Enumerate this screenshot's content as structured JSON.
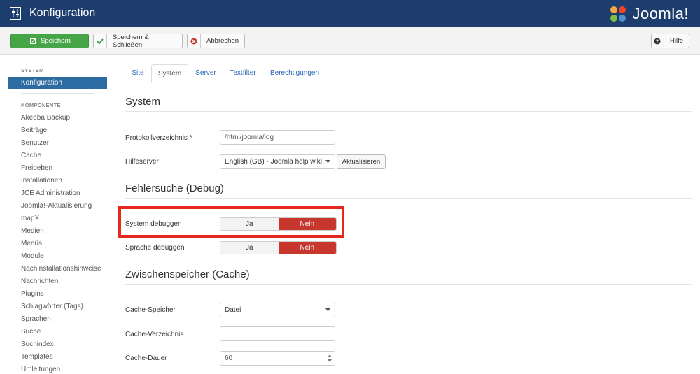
{
  "header": {
    "title": "Konfiguration",
    "brand": "Joomla!"
  },
  "toolbar": {
    "save_label": "Speichern",
    "save_close_label": "Speichern & Schließen",
    "cancel_label": "Abbrechen",
    "help_label": "Hilfe"
  },
  "sidebar": {
    "system_heading": "SYSTEM",
    "active_item": "Konfiguration",
    "components_heading": "KOMPONENTE",
    "items": [
      "Akeeba Backup",
      "Beiträge",
      "Benutzer",
      "Cache",
      "Freigeben",
      "Installationen",
      "JCE Administration",
      "Joomla!-Aktualisierung",
      "mapX",
      "Medien",
      "Menüs",
      "Module",
      "Nachinstallationshinweise",
      "Nachrichten",
      "Plugins",
      "Schlagwörter (Tags)",
      "Sprachen",
      "Suche",
      "Suchindex",
      "Templates",
      "Umleitungen"
    ]
  },
  "tabs": [
    "Site",
    "System",
    "Server",
    "Textfilter",
    "Berechtigungen"
  ],
  "active_tab": "System",
  "sections": {
    "system": {
      "title": "System",
      "log_label": "Protokollverzeichnis *",
      "log_value": "/html/joomla/log",
      "help_server_label": "Hilfeserver",
      "help_server_value": "English (GB) - Joomla help wiki",
      "update_button": "Aktualisieren"
    },
    "debug": {
      "title": "Fehlersuche (Debug)",
      "system_debug_label": "System debuggen",
      "language_debug_label": "Sprache debuggen",
      "yes_label": "Ja",
      "no_label": "Nein",
      "system_debug_selected": "Nein",
      "language_debug_selected": "Nein"
    },
    "cache": {
      "title": "Zwischenspeicher (Cache)",
      "handler_label": "Cache-Speicher",
      "handler_value": "Datei",
      "path_label": "Cache-Verzeichnis",
      "path_value": "",
      "time_label": "Cache-Dauer",
      "time_value": "60"
    }
  },
  "colors": {
    "header_bg": "#1c3d6e",
    "save_green": "#46a546",
    "active_blue": "#2d6ca2",
    "toggle_red": "#c8372d",
    "highlight_red": "#e8271c"
  }
}
